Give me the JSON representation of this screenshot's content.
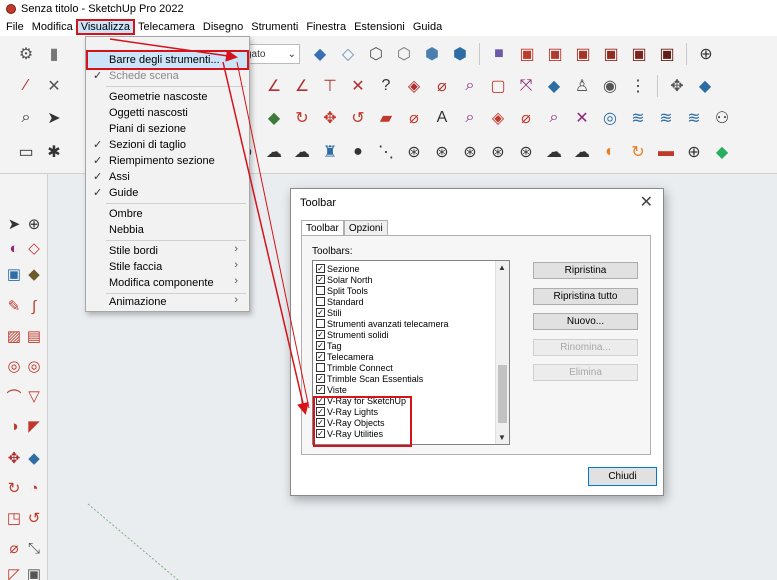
{
  "window": {
    "title": "Senza titolo - SketchUp Pro 2022"
  },
  "menubar": {
    "items": [
      "File",
      "Modifica",
      "Visualizza",
      "Telecamera",
      "Disegno",
      "Strumenti",
      "Finestra",
      "Estensioni",
      "Guida"
    ],
    "open_index": 2
  },
  "toolbar": {
    "style_select_value": "gato"
  },
  "view_menu": {
    "items": [
      {
        "label": "Barre degli strumenti...",
        "checked": false,
        "submenu": false,
        "state": "highlighted"
      },
      {
        "label": "Schede scena",
        "checked": true,
        "submenu": false,
        "state": "disabled"
      },
      {
        "label": "Geometrie nascoste",
        "checked": false,
        "submenu": false,
        "state": "normal"
      },
      {
        "label": "Oggetti nascosti",
        "checked": false,
        "submenu": false,
        "state": "normal"
      },
      {
        "label": "Piani di sezione",
        "checked": false,
        "submenu": false,
        "state": "normal"
      },
      {
        "label": "Sezioni di taglio",
        "checked": true,
        "submenu": false,
        "state": "normal"
      },
      {
        "label": "Riempimento sezione",
        "checked": true,
        "submenu": false,
        "state": "normal"
      },
      {
        "label": "Assi",
        "checked": true,
        "submenu": false,
        "state": "normal"
      },
      {
        "label": "Guide",
        "checked": true,
        "submenu": false,
        "state": "normal"
      },
      {
        "label": "Ombre",
        "checked": false,
        "submenu": false,
        "state": "normal"
      },
      {
        "label": "Nebbia",
        "checked": false,
        "submenu": false,
        "state": "normal"
      },
      {
        "label": "Stile bordi",
        "checked": false,
        "submenu": true,
        "state": "normal"
      },
      {
        "label": "Stile faccia",
        "checked": false,
        "submenu": true,
        "state": "normal"
      },
      {
        "label": "Modifica componente",
        "checked": false,
        "submenu": true,
        "state": "normal"
      },
      {
        "label": "Animazione",
        "checked": false,
        "submenu": true,
        "state": "normal"
      }
    ]
  },
  "dialog": {
    "title": "Toolbar",
    "close_glyph": "✕",
    "tabs": [
      "Toolbar",
      "Opzioni"
    ],
    "active_tab": 0,
    "list_label": "Toolbars:",
    "toolbars": [
      {
        "label": "Sezione",
        "checked": true
      },
      {
        "label": "Solar North",
        "checked": true
      },
      {
        "label": "Split Tools",
        "checked": false
      },
      {
        "label": "Standard",
        "checked": false
      },
      {
        "label": "Stili",
        "checked": true
      },
      {
        "label": "Strumenti avanzati telecamera",
        "checked": false
      },
      {
        "label": "Strumenti solidi",
        "checked": true
      },
      {
        "label": "Tag",
        "checked": true
      },
      {
        "label": "Telecamera",
        "checked": true
      },
      {
        "label": "Trimble Connect",
        "checked": false
      },
      {
        "label": "Trimble Scan Essentials",
        "checked": true
      },
      {
        "label": "Viste",
        "checked": true
      },
      {
        "label": "V-Ray for SketchUp",
        "checked": true
      },
      {
        "label": "V-Ray Lights",
        "checked": true
      },
      {
        "label": "V-Ray Objects",
        "checked": true
      },
      {
        "label": "V-Ray Utilities",
        "checked": true
      }
    ],
    "buttons": {
      "reset": "Ripristina",
      "reset_all": "Ripristina tutto",
      "new": "Nuovo...",
      "rename": "Rinomina...",
      "delete": "Elimina",
      "close": "Chiudi"
    }
  },
  "colors": {
    "annotation_red": "#d6121a",
    "menu_highlight": "#cce4f7"
  }
}
